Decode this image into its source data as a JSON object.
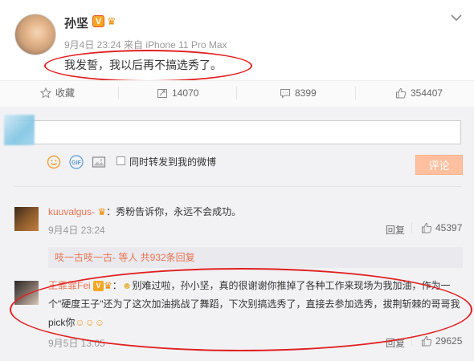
{
  "post": {
    "author": "孙坚",
    "meta": "9月4日 23:24 来自 iPhone 11 Pro Max",
    "text": "我发誓，我以后再不搞选秀了。"
  },
  "actions": {
    "favorite": "收藏",
    "repost": "14070",
    "comment": "8399",
    "like": "354407"
  },
  "compose": {
    "also_repost_label": "同时转发到我的微博",
    "submit_label": "评论"
  },
  "comments": [
    {
      "user": "kuuvalgus-",
      "sep": "：",
      "text": "秀粉告诉你，永远不会成功。",
      "time": "9月4日 23:24",
      "reply_label": "回复",
      "likes": "45397"
    },
    {
      "user": "王霏霏Fei",
      "sep": "：",
      "text_line1": "别难过啦，孙小坚，真的很谢谢你推掉了各种工作来现场为我加油，作为一",
      "text_line2": "个\"硬度王子\"还为了这次加油挑战了舞蹈，下次别搞选秀了，直接去参加选秀，拔荆斩棘的哥哥我",
      "text_line3": "pick你",
      "time": "9月5日 13:05",
      "reply_label": "回复",
      "likes": "29625"
    }
  ],
  "sub_reply": {
    "text": "吱一古吱一古- 等人 共932条回复"
  },
  "colors": {
    "accent": "#eb7350",
    "highlight_oval": "#e02020",
    "submit_bg": "#ffc09f"
  }
}
